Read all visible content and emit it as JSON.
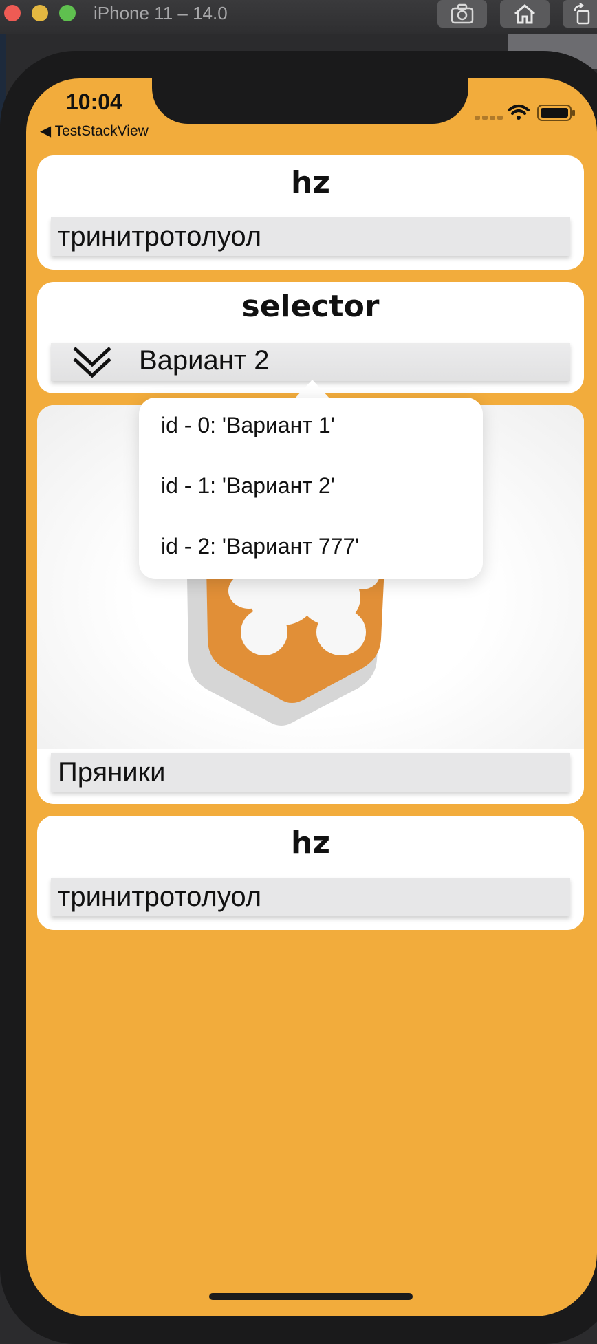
{
  "simulator": {
    "title": "iPhone 11 – 14.0",
    "buttons": [
      "screenshot-icon",
      "home-icon",
      "rotate-icon"
    ]
  },
  "status_bar": {
    "time": "10:04",
    "back_label": "TestStackView"
  },
  "cards": {
    "first": {
      "title": "hz",
      "field_value": "тринитротолуол"
    },
    "selector": {
      "title": "selector",
      "selected_value": "Вариант 2"
    },
    "image": {
      "field_value": "Пряники"
    },
    "last": {
      "title": "hz",
      "field_value": "тринитротолуол"
    }
  },
  "popover": {
    "items": [
      "id - 0: 'Вариант 1'",
      "id - 1: 'Вариант 2'",
      "id - 2: 'Вариант 777'"
    ]
  },
  "colors": {
    "background": "#f2ac3c",
    "card": "#ffffff",
    "field": "#e7e7e8",
    "logo_orange": "#e0923a"
  }
}
